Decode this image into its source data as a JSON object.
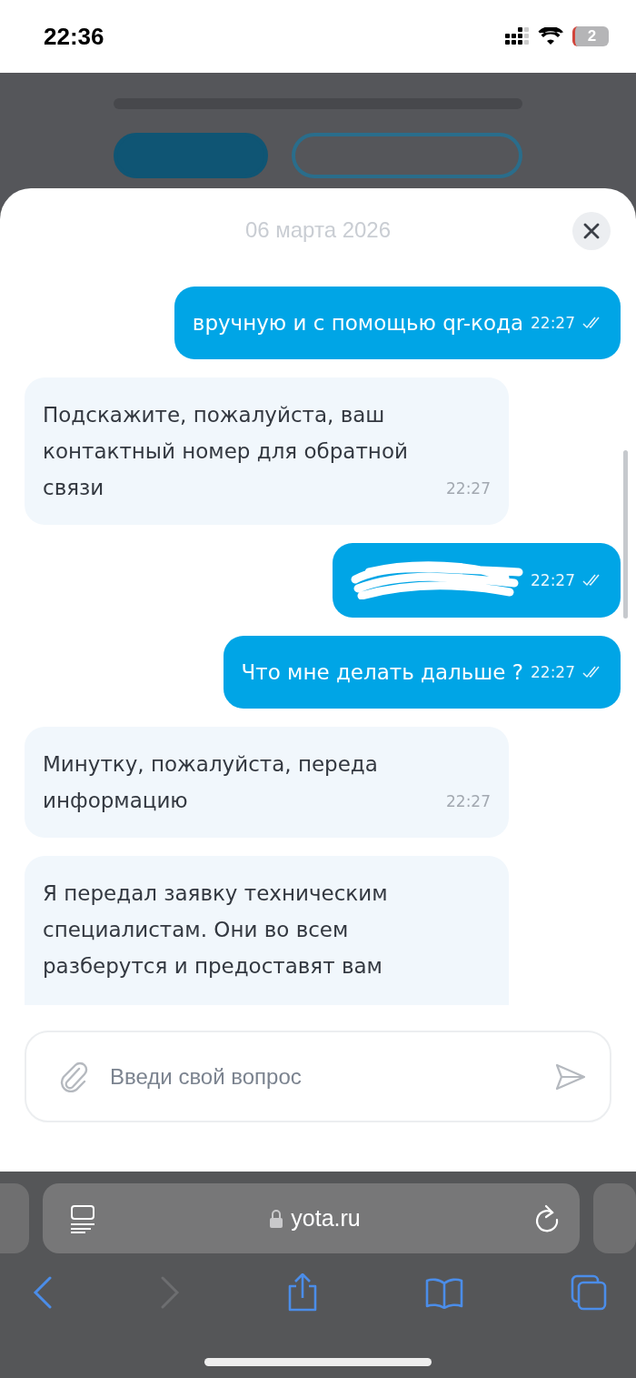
{
  "status_bar": {
    "time": "22:36",
    "battery": "2"
  },
  "chat": {
    "date": "06 марта 2026",
    "messages": [
      {
        "kind": "outgoing",
        "text": "вручную и с помощью qr-кода",
        "time": "22:27",
        "read": true,
        "redacted": false
      },
      {
        "kind": "incoming",
        "text": "Подскажите, пожалуйста, ваш контактный номер для обратной связи",
        "time": "22:27"
      },
      {
        "kind": "outgoing",
        "time": "22:27",
        "read": true,
        "redacted": true
      },
      {
        "kind": "outgoing",
        "text": "Что мне делать дальше ?",
        "time": "22:27",
        "read": true,
        "redacted": false
      },
      {
        "kind": "incoming",
        "text": "Минутку, пожалуйста, переда информацию",
        "time": "22:27"
      },
      {
        "kind": "incoming",
        "text": "Я передал заявку техническим специалистам. Они во всем разберутся и предоставят вам"
      }
    ],
    "input": {
      "placeholder": "Введи свой вопрос"
    }
  },
  "browser": {
    "url": "yota.ru"
  }
}
